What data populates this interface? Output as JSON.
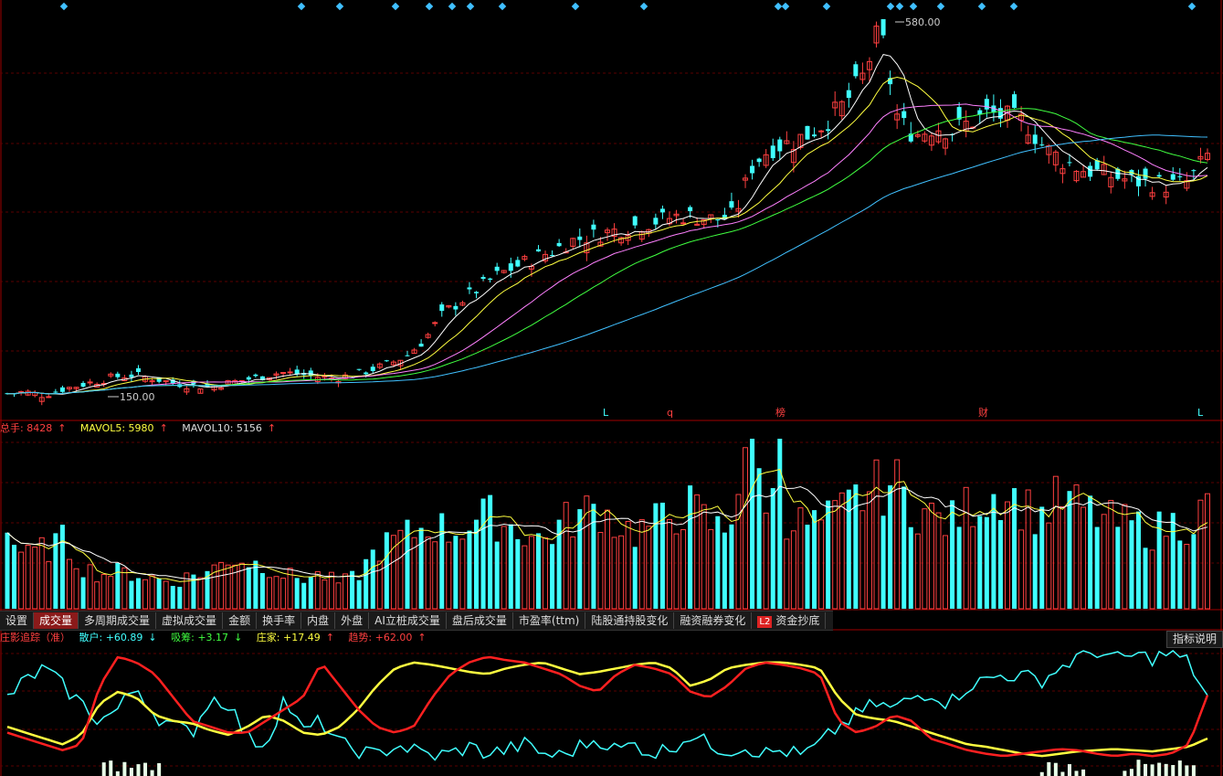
{
  "price_panel": {
    "high_label": "580.00",
    "low_label": "150.00",
    "event_markers": [
      {
        "text": "L",
        "color": "#40ffff"
      },
      {
        "text": "q",
        "color": "#ff4040"
      },
      {
        "text": "榜",
        "color": "#ff4040"
      },
      {
        "text": "财",
        "color": "#ff4040"
      },
      {
        "text": "L",
        "color": "#40ffff"
      }
    ]
  },
  "volume_panel": {
    "total_label": "总手: 8428",
    "total_arrow": "↑",
    "ma5_label": "MAVOL5: 5980",
    "ma5_arrow": "↑",
    "ma10_label": "MAVOL10: 5156",
    "ma10_arrow": "↑"
  },
  "tabs": [
    {
      "label": "设置",
      "active": false
    },
    {
      "label": "成交量",
      "active": true
    },
    {
      "label": "多周期成交量",
      "active": false
    },
    {
      "label": "虚拟成交量",
      "active": false
    },
    {
      "label": "金额",
      "active": false
    },
    {
      "label": "换手率",
      "active": false
    },
    {
      "label": "内盘",
      "active": false
    },
    {
      "label": "外盘",
      "active": false
    },
    {
      "label": "AI立桩成交量",
      "active": false
    },
    {
      "label": "盘后成交量",
      "active": false
    },
    {
      "label": "市盈率(ttm)",
      "active": false
    },
    {
      "label": "陆股通持股变化",
      "active": false
    },
    {
      "label": "融资融券变化",
      "active": false
    },
    {
      "label": "资金抄底",
      "active": false,
      "badge": "L2"
    }
  ],
  "indicator_panel": {
    "name": "庄影追踪（准）",
    "retail_label": "散户: +60.89",
    "retail_arrow": "↓",
    "absorb_label": "吸筹: +3.17",
    "absorb_arrow": "↓",
    "dealer_label": "庄家: +17.49",
    "dealer_arrow": "↑",
    "trend_label": "趋势: +62.00",
    "trend_arrow": "↑",
    "help_button": "指标说明"
  },
  "colors": {
    "up": "#ff4040",
    "down": "#40ffff",
    "ma5": "#ffffff",
    "ma10": "#ffff40",
    "ma20": "#ff80ff",
    "ma30": "#40ff40",
    "ma60": "#40c0ff",
    "grid": "#5a0000"
  },
  "chart_data": {
    "type": "candlestick",
    "ylim_hint": [
      150,
      580
    ],
    "price_anchors": [
      150,
      152,
      148,
      155,
      160,
      165,
      170,
      172,
      168,
      163,
      160,
      158,
      162,
      166,
      170,
      175,
      173,
      170,
      168,
      172,
      178,
      185,
      195,
      215,
      245,
      260,
      275,
      290,
      300,
      310,
      318,
      330,
      335,
      340,
      345,
      350,
      355,
      360,
      358,
      355,
      360,
      420,
      440,
      445,
      455,
      470,
      490,
      520,
      580,
      470,
      455,
      465,
      460,
      470,
      480,
      475,
      470,
      440,
      425,
      415,
      410,
      405,
      400,
      398,
      395,
      400,
      430
    ],
    "volume_anchors": [
      0.45,
      0.3,
      0.35,
      0.4,
      0.25,
      0.2,
      0.22,
      0.2,
      0.18,
      0.15,
      0.2,
      0.22,
      0.3,
      0.28,
      0.25,
      0.2,
      0.18,
      0.2,
      0.15,
      0.2,
      0.35,
      0.4,
      0.45,
      0.5,
      0.45,
      0.5,
      0.55,
      0.5,
      0.45,
      0.4,
      0.5,
      0.55,
      0.6,
      0.5,
      0.45,
      0.5,
      0.55,
      0.6,
      0.5,
      0.45,
      1.0,
      0.7,
      0.55,
      0.5,
      0.5,
      0.55,
      0.65,
      0.7,
      0.75,
      0.6,
      0.55,
      0.5,
      0.6,
      0.65,
      0.7,
      0.6,
      0.55,
      0.65,
      0.6,
      0.55,
      0.5,
      0.5,
      0.45,
      0.5,
      0.5,
      0.6
    ],
    "indicator_series": [
      {
        "name": "散户",
        "color": "#40ffff",
        "values": [
          60,
          75,
          85,
          70,
          55,
          40,
          50,
          70,
          45,
          35,
          30,
          60,
          55,
          25,
          20,
          60,
          30,
          40,
          20,
          15,
          10,
          20,
          15,
          10,
          12,
          18,
          12,
          15,
          20,
          12,
          10,
          18,
          25,
          15,
          20,
          12,
          18,
          28,
          20,
          15,
          18,
          12,
          15,
          10,
          20,
          35,
          45,
          55,
          50,
          60,
          65,
          55,
          70,
          75,
          80,
          78,
          75,
          85,
          95,
          100,
          92,
          96,
          94,
          98,
          90,
          60
        ]
      },
      {
        "name": "庄家",
        "color": "#ffff40",
        "values": [
          35,
          30,
          25,
          20,
          28,
          55,
          65,
          60,
          45,
          40,
          38,
          32,
          28,
          35,
          45,
          40,
          30,
          28,
          35,
          50,
          70,
          85,
          90,
          88,
          85,
          82,
          80,
          85,
          88,
          90,
          85,
          80,
          82,
          85,
          88,
          90,
          85,
          70,
          75,
          85,
          88,
          90,
          90,
          88,
          85,
          60,
          45,
          42,
          40,
          35,
          30,
          25,
          20,
          18,
          15,
          12,
          10,
          12,
          14,
          15,
          16,
          15,
          14,
          16,
          18,
          25
        ]
      },
      {
        "name": "趋势",
        "color": "#ff2020",
        "values": [
          30,
          25,
          20,
          15,
          20,
          70,
          95,
          90,
          80,
          60,
          40,
          35,
          30,
          30,
          40,
          50,
          60,
          90,
          70,
          50,
          35,
          30,
          35,
          60,
          80,
          90,
          95,
          92,
          90,
          85,
          80,
          70,
          65,
          80,
          88,
          85,
          80,
          65,
          60,
          70,
          85,
          90,
          88,
          85,
          80,
          40,
          30,
          35,
          45,
          40,
          25,
          20,
          15,
          12,
          10,
          12,
          14,
          16,
          15,
          12,
          10,
          12,
          10,
          12,
          20,
          62
        ]
      }
    ]
  }
}
